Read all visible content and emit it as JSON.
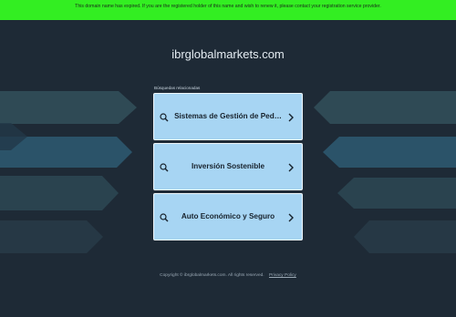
{
  "banner": {
    "text": "This domain name has expired. If you are the registered holder of this name and wish to renew it, please contact your registration service provider."
  },
  "header": {
    "domain": "ibrglobalmarkets.com"
  },
  "related": {
    "heading": "Búsquedas relacionadas",
    "items": [
      {
        "label": "Sistemas de Gestión de Ped…"
      },
      {
        "label": "Inversión Sostenible"
      },
      {
        "label": "Auto Económico y Seguro"
      }
    ]
  },
  "footer": {
    "copyright": "Copyright © ibrglobalmarkets.com.  All rights reserved.",
    "privacy_link": "Privacy Policy"
  },
  "colors": {
    "banner_bg": "#33ee22",
    "page_bg": "#1e2a36",
    "card_bg": "#a7d5f3"
  },
  "icons": {
    "card_left": "search-icon",
    "card_right": "chevron-right-icon"
  }
}
